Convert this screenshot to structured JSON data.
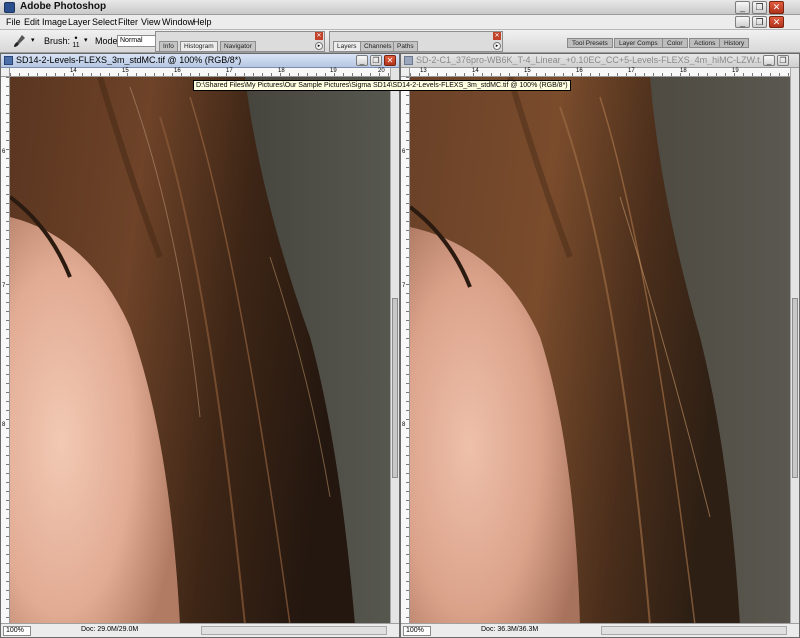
{
  "app": {
    "title": "Adobe Photoshop",
    "window_controls": {
      "minimize": "_",
      "restore": "❐",
      "close": "✕"
    }
  },
  "menu": [
    "File",
    "Edit",
    "Image",
    "Layer",
    "Select",
    "Filter",
    "View",
    "Window",
    "Help"
  ],
  "options_bar": {
    "brush_label": "Brush:",
    "brush_size": "11",
    "mode_label": "Mode:",
    "mode_value": "Normal"
  },
  "palettes": {
    "well1_tabs": [
      "Info",
      "Histogram",
      "Navigator"
    ],
    "well1_active": "Histogram",
    "well2_tabs": [
      "Layers",
      "Channels",
      "Paths"
    ],
    "well2_active": "Layers",
    "dock_tabs": [
      "Tool Presets",
      "Layer Comps",
      "Color",
      "Actions",
      "History"
    ]
  },
  "documents": [
    {
      "title": "SD14-2-Levels-FLEXS_3m_stdMC.tif @ 100% (RGB/8*)",
      "active": true,
      "zoom": "100%",
      "doc_size": "Doc: 29.0M/29.0M",
      "ruler_h": [
        "14",
        "15",
        "16",
        "17",
        "18",
        "19",
        "20"
      ],
      "ruler_v": [
        "6",
        "7",
        "8"
      ]
    },
    {
      "title": "SD-2-C1_376pro-WB6K_T-4_Linear_+0.10EC_CC+5-Levels-FLEXS_4m_hiMC-LZW.t...",
      "active": false,
      "zoom": "100%",
      "doc_size": "Doc: 36.3M/36.3M",
      "ruler_h": [
        "13",
        "14",
        "15",
        "16",
        "17",
        "18",
        "19"
      ],
      "ruler_v": [
        "6",
        "7",
        "8"
      ]
    }
  ],
  "tooltip": "D:\\Shared Files\\My Pictures\\Our Sample Pictures\\Sigma SD14\\SD14-2-Levels-FLEXS_3m_stdMC.tif @ 100% (RGB/8*)",
  "colors": {
    "hair_dark": "#3a2417",
    "hair_mid": "#6b4227",
    "skin": "#e9b8a4",
    "background_gray": "#4a4b46"
  },
  "icons": [
    "brush-tool-icon",
    "file-browser-icon",
    "photoshop-app-icon",
    "document-icon"
  ]
}
